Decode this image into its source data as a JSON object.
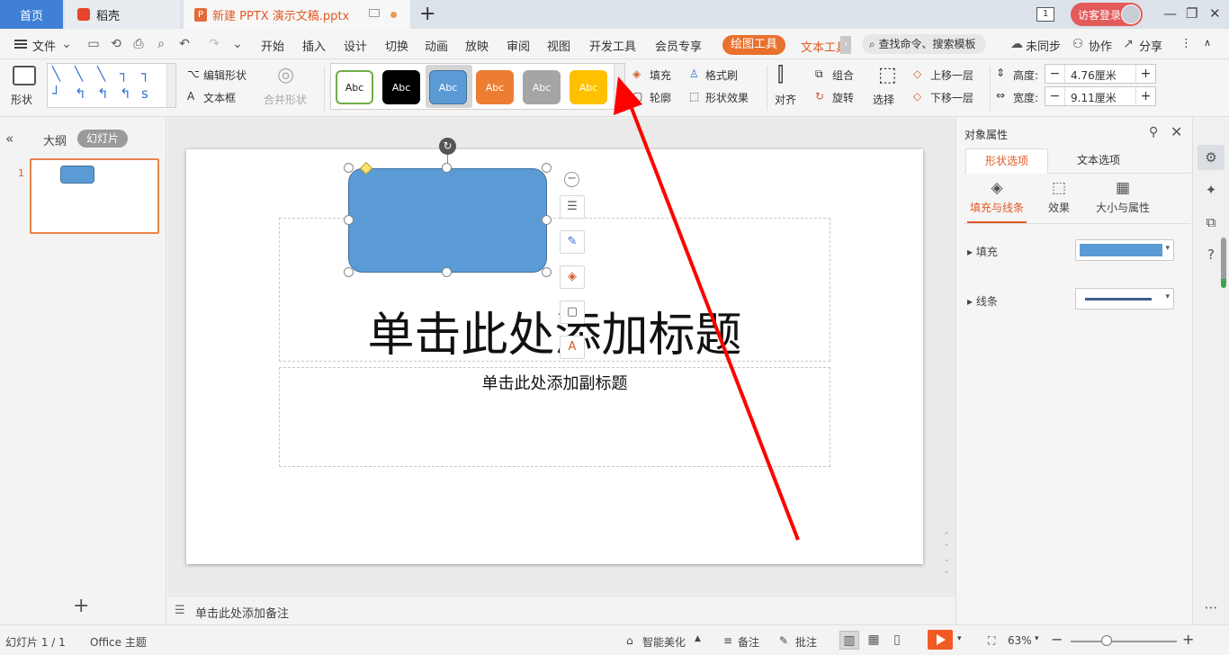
{
  "tabs": {
    "home": "首页",
    "daoke": "稻壳",
    "doc": "新建 PPTX 演示文稿.pptx",
    "add": "+"
  },
  "titlebar": {
    "window_num": "1",
    "login": "访客登录",
    "minimize": "—",
    "restore": "❐",
    "close": "✕"
  },
  "menu": {
    "file": "文件",
    "items": [
      "开始",
      "插入",
      "设计",
      "切换",
      "动画",
      "放映",
      "审阅",
      "视图",
      "开发工具",
      "会员专享"
    ],
    "draw_tool": "绘图工具",
    "text_tool": "文本工具",
    "search": "查找命令、搜索模板",
    "sync": "未同步",
    "collab": "协作",
    "share": "分享"
  },
  "ribbon": {
    "shape": "形状",
    "edit_shape": "编辑形状",
    "textbox": "文本框",
    "merge_shape": "合并形状",
    "styles": [
      "Abc",
      "Abc",
      "Abc",
      "Abc",
      "Abc",
      "Abc"
    ],
    "fill": "填充",
    "format_brush": "格式刷",
    "outline": "轮廓",
    "shape_effect": "形状效果",
    "align": "对齐",
    "group": "组合",
    "rotate": "旋转",
    "select": "选择",
    "bring_forward": "上移一层",
    "send_backward": "下移一层",
    "height_label": "高度:",
    "height_value": "4.76厘米",
    "width_label": "宽度:",
    "width_value": "9.11厘米"
  },
  "left_panel": {
    "outline": "大纲",
    "slides": "幻灯片",
    "slide_number": "1"
  },
  "slide": {
    "title": "单击此处添加标题",
    "subtitle": "单击此处添加副标题"
  },
  "notes": "单击此处添加备注",
  "right_panel": {
    "title": "对象属性",
    "tab_shape": "形状选项",
    "tab_text": "文本选项",
    "sub_fill_line": "填充与线条",
    "sub_effect": "效果",
    "sub_size": "大小与属性",
    "fill": "填充",
    "line": "线条"
  },
  "status": {
    "slide_info": "幻灯片 1 / 1",
    "theme": "Office 主题",
    "smart": "智能美化",
    "notes": "备注",
    "comment": "批注",
    "zoom": "63%"
  },
  "colors": {
    "accent": "#e8712d",
    "shape_fill": "#5b9bd5",
    "home_tab": "#3f80d6",
    "arrow": "#ff0000"
  }
}
